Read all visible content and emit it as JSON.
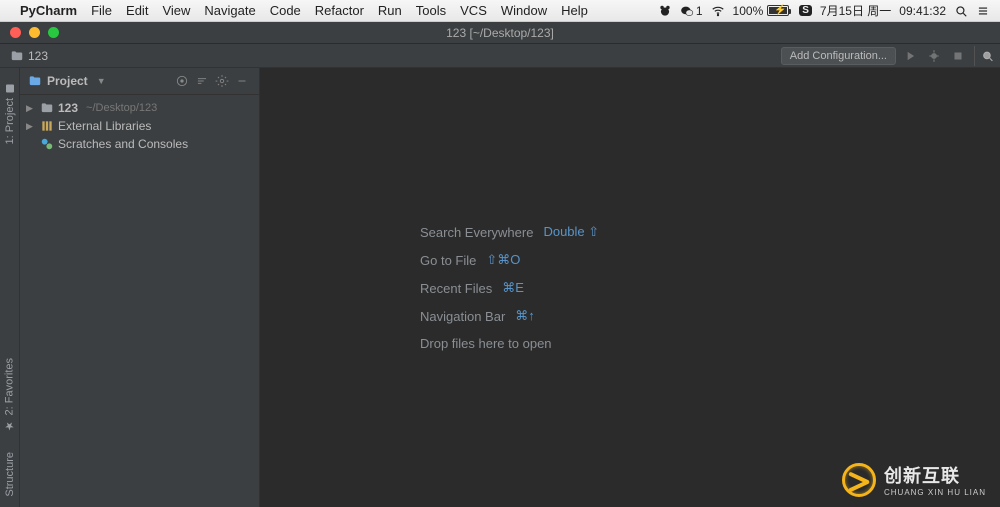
{
  "mac_menu": {
    "app": "PyCharm",
    "items": [
      "File",
      "Edit",
      "View",
      "Navigate",
      "Code",
      "Refactor",
      "Run",
      "Tools",
      "VCS",
      "Window",
      "Help"
    ],
    "wechat_badge": "1",
    "battery_label": "100%",
    "date_label": "7月15日 周一",
    "time_label": "09:41:32"
  },
  "window": {
    "title": "123 [~/Desktop/123]"
  },
  "breadcrumb": {
    "root": "123"
  },
  "toolbar": {
    "add_config": "Add Configuration..."
  },
  "project_panel": {
    "title": "Project"
  },
  "tree": {
    "root": {
      "name": "123",
      "path": "~/Desktop/123"
    },
    "ext_lib": "External Libraries",
    "scratches": "Scratches and Consoles"
  },
  "welcome": {
    "l1_label": "Search Everywhere",
    "l1_key": "Double ⇧",
    "l2_label": "Go to File",
    "l2_key": "⇧⌘O",
    "l3_label": "Recent Files",
    "l3_key": "⌘E",
    "l4_label": "Navigation Bar",
    "l4_key": "⌘↑",
    "l5_label": "Drop files here to open"
  },
  "gutter": {
    "project_tab": "1: Project",
    "favorites_tab": "2: Favorites",
    "structure_tab": "Structure"
  },
  "watermark": {
    "cn": "创新互联",
    "en": "CHUANG XIN HU LIAN"
  }
}
